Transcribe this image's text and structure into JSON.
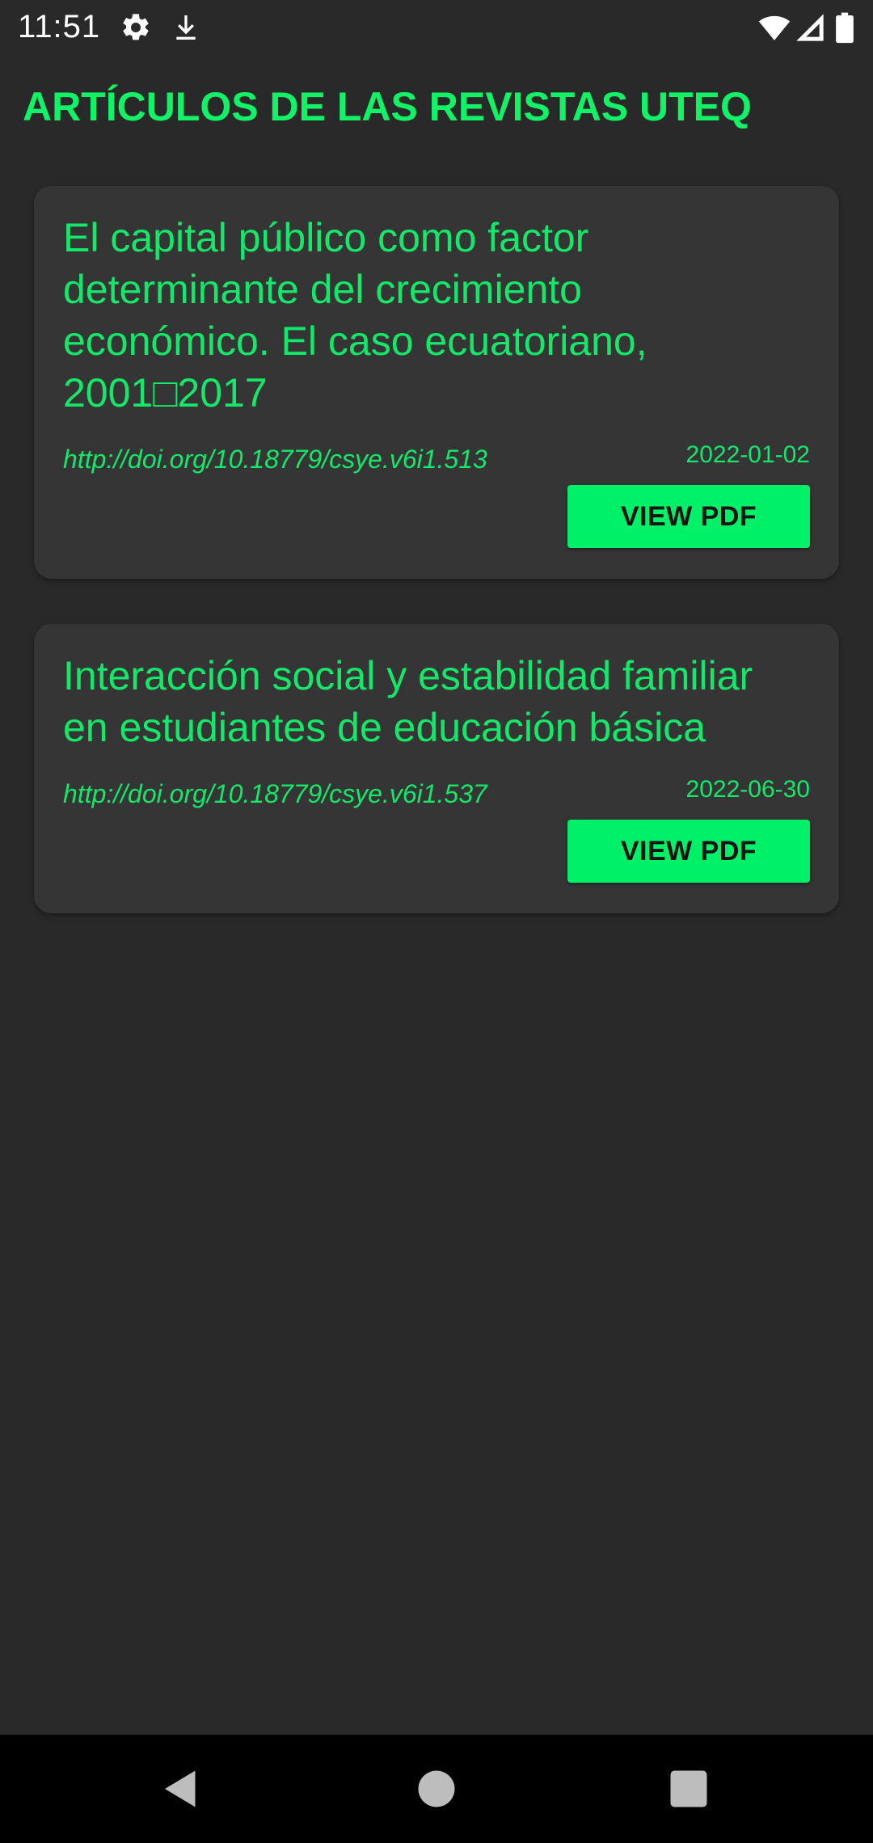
{
  "status_bar": {
    "time": "11:51",
    "icons": [
      "settings-icon",
      "download-icon",
      "wifi-icon",
      "signal-icon",
      "battery-icon"
    ]
  },
  "app": {
    "title": "ARTÍCULOS DE LAS REVISTAS UTEQ",
    "accent_color": "#12f266",
    "background_color": "#292929",
    "card_color": "#353535"
  },
  "articles": [
    {
      "title": "El capital público como factor determinante del crecimiento económico. El caso ecuatoriano, 2001□2017",
      "doi": "http://doi.org/10.18779/csye.v6i1.513",
      "date": "2022-01-02",
      "button_label": "VIEW PDF"
    },
    {
      "title": "Interacción social y estabilidad familiar en estudiantes de educación básica",
      "doi": "http://doi.org/10.18779/csye.v6i1.537",
      "date": "2022-06-30",
      "button_label": "VIEW PDF"
    }
  ],
  "nav_bar": {
    "buttons": [
      "back-icon",
      "home-icon",
      "recents-icon"
    ]
  }
}
